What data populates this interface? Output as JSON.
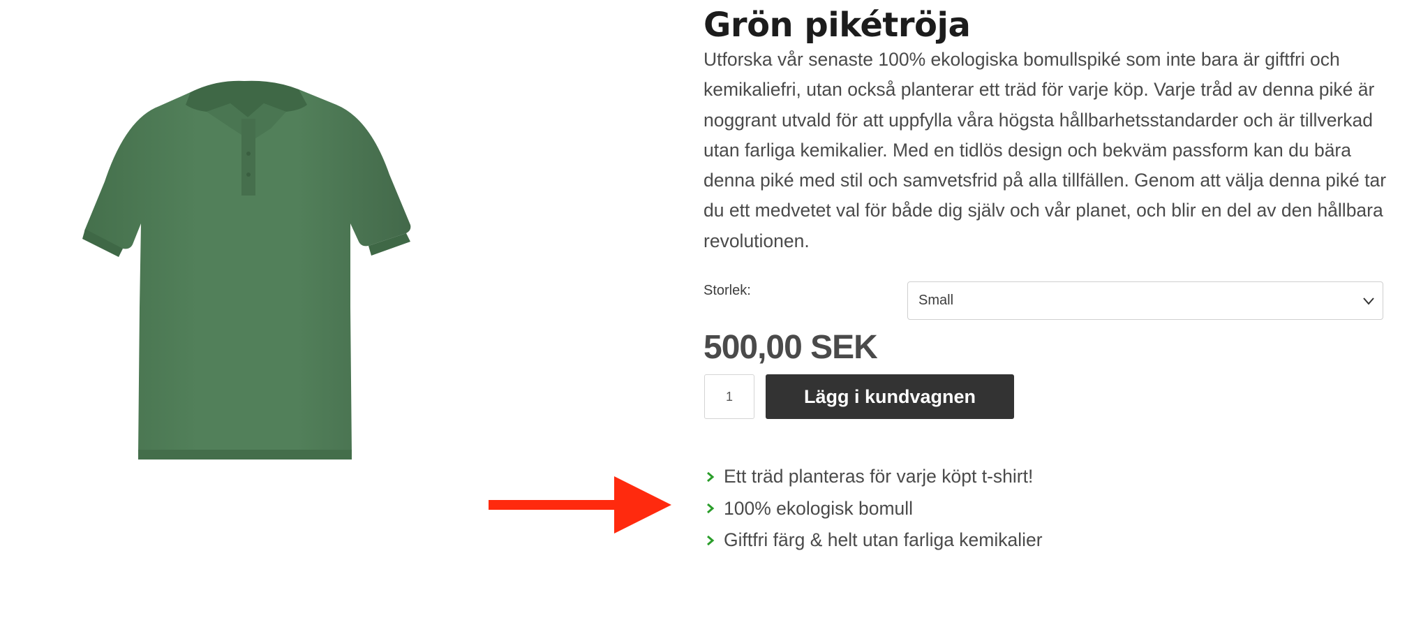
{
  "product": {
    "title": "Grön pikétröja",
    "description": "Utforska vår senaste 100% ekologiska bomullspiké som inte bara är giftfri och kemikaliefri, utan också planterar ett träd för varje köp. Varje tråd av denna piké är noggrant utvald för att uppfylla våra högsta hållbarhetsstandarder och är tillverkad utan farliga kemikalier. Med en tidlös design och bekväm passform kan du bära denna piké med stil och samvetsfrid på alla tillfällen. Genom att välja denna piké tar du ett medvetet val för både dig själv och vår planet, och blir en del av den hållbara revolutionen.",
    "image_icon": "green-polo-shirt-image",
    "shirt_color": "#4e7a55"
  },
  "options": {
    "size_label": "Storlek:",
    "size_selected": "Small"
  },
  "purchase": {
    "price": "500,00 SEK",
    "quantity": "1",
    "add_to_cart_label": "Lägg i kundvagnen",
    "button_color": "#333333"
  },
  "features": [
    "Ett träd planteras för varje köpt t-shirt!",
    "100% ekologisk bomull",
    "Giftfri färg & helt utan farliga kemikalier"
  ],
  "colors": {
    "check_color": "#2a9d2a",
    "annotation_arrow": "#ff2a0e"
  }
}
